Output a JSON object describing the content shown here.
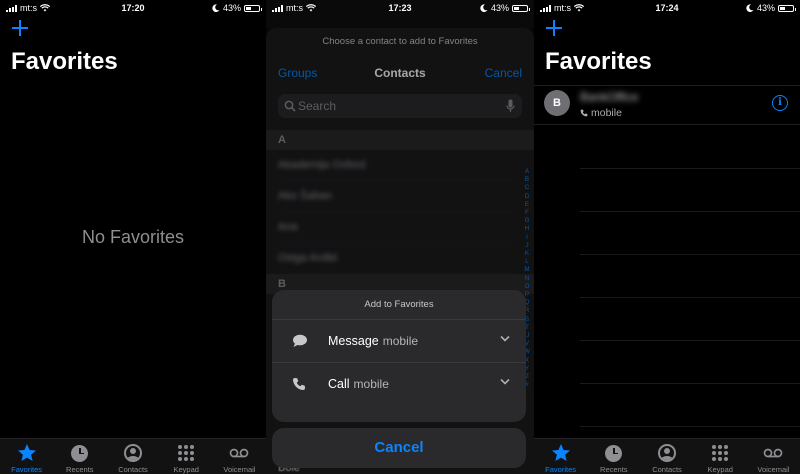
{
  "status_bars": [
    {
      "carrier": "mt:s",
      "time": "17:20",
      "battery": "43%"
    },
    {
      "carrier": "mt:s",
      "time": "17:23",
      "battery": "43%"
    },
    {
      "carrier": "mt:s",
      "time": "17:24",
      "battery": "43%"
    }
  ],
  "screen1": {
    "title": "Favorites",
    "empty_text": "No Favorites"
  },
  "screen2": {
    "prompt": "Choose a contact to add to Favorites",
    "nav": {
      "left": "Groups",
      "title": "Contacts",
      "right": "Cancel"
    },
    "search_placeholder": "Search",
    "sections": [
      {
        "letter": "A",
        "contacts": [
          "Akademija Oxford",
          "Ako Šaban",
          "Ana",
          "Osiga Anđel"
        ]
      },
      {
        "letter": "B",
        "contacts": [
          "Bole"
        ]
      }
    ],
    "index": [
      "A",
      "B",
      "C",
      "D",
      "E",
      "F",
      "G",
      "H",
      "I",
      "J",
      "K",
      "L",
      "M",
      "N",
      "O",
      "P",
      "Q",
      "R",
      "S",
      "T",
      "U",
      "V",
      "W",
      "X",
      "Y",
      "Z",
      "#"
    ],
    "action_sheet": {
      "title": "Add to Favorites",
      "options": [
        {
          "label": "Message",
          "detail": "mobile",
          "icon": "message-bubble-icon"
        },
        {
          "label": "Call",
          "detail": "mobile",
          "icon": "phone-icon"
        }
      ],
      "cancel": "Cancel"
    }
  },
  "screen3": {
    "title": "Favorites",
    "favorites": [
      {
        "initial": "B",
        "name": "BankOffice",
        "type": "mobile"
      }
    ]
  },
  "tabbar": [
    {
      "label": "Favorites",
      "icon": "star-icon"
    },
    {
      "label": "Recents",
      "icon": "clock-icon"
    },
    {
      "label": "Contacts",
      "icon": "person-circle-icon"
    },
    {
      "label": "Keypad",
      "icon": "keypad-icon"
    },
    {
      "label": "Voicemail",
      "icon": "voicemail-icon"
    }
  ],
  "colors": {
    "accent": "#0a84ff",
    "background": "#000000",
    "sheet": "#1c1c1e",
    "secondary_text": "#8e8e93"
  }
}
